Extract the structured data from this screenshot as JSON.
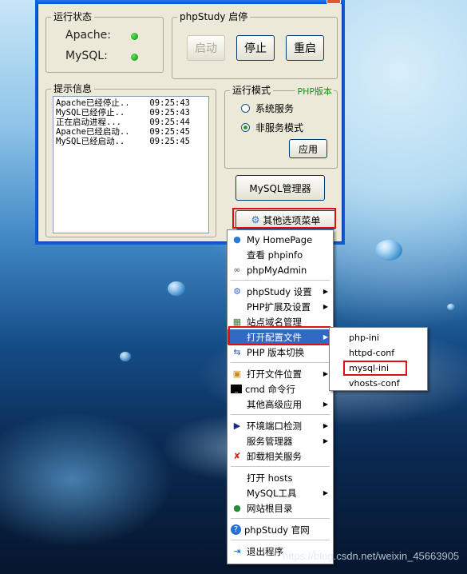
{
  "status_group": {
    "label": "运行状态",
    "apache": "Apache:",
    "mysql": "MySQL:"
  },
  "control_group": {
    "label": "phpStudy 启停",
    "start": "启动",
    "stop": "停止",
    "restart": "重启"
  },
  "log_group": {
    "label": "提示信息",
    "lines": [
      {
        "msg": "Apache已经停止..",
        "time": "09:25:43"
      },
      {
        "msg": "MySQL已经停止..",
        "time": "09:25:43"
      },
      {
        "msg": "正在启动进程...",
        "time": "09:25:44"
      },
      {
        "msg": "Apache已经启动..",
        "time": "09:25:45"
      },
      {
        "msg": "MySQL已经启动..",
        "time": "09:25:45"
      }
    ]
  },
  "mode_group": {
    "label": "运行模式",
    "php_version": "PHP版本",
    "system_service": "系统服务",
    "non_service": "非服务模式",
    "apply": "应用"
  },
  "mysql_manager": "MySQL管理器",
  "other_menu": "其他选项菜单",
  "menu": {
    "items": [
      {
        "label": "My HomePage",
        "icon": "globe-icon"
      },
      {
        "label": "查看 phpinfo",
        "icon": ""
      },
      {
        "label": "phpMyAdmin",
        "icon": "link-icon"
      },
      {
        "label": "phpStudy 设置",
        "icon": "gear-icon",
        "submenu": true
      },
      {
        "label": "PHP扩展及设置",
        "icon": "",
        "submenu": true
      },
      {
        "label": "站点域名管理",
        "icon": "sites-icon"
      },
      {
        "label": "打开配置文件",
        "icon": "",
        "submenu": true
      },
      {
        "label": "PHP 版本切换",
        "icon": "switch-icon"
      },
      {
        "label": "打开文件位置",
        "icon": "folder-icon",
        "submenu": true
      },
      {
        "label": "cmd 命令行",
        "icon": "terminal-icon"
      },
      {
        "label": "其他高级应用",
        "icon": "",
        "submenu": true
      },
      {
        "label": "环境端口检测",
        "icon": "play-icon",
        "submenu": true
      },
      {
        "label": "服务管理器",
        "icon": "",
        "submenu": true
      },
      {
        "label": "卸载相关服务",
        "icon": "uninstall-icon"
      },
      {
        "label": "打开 hosts",
        "icon": ""
      },
      {
        "label": "MySQL工具",
        "icon": "",
        "submenu": true
      },
      {
        "label": "网站根目录",
        "icon": "webroot-icon"
      },
      {
        "label": "phpStudy 官网",
        "icon": "help-icon"
      },
      {
        "label": "退出程序",
        "icon": "exit-icon"
      }
    ]
  },
  "submenu": {
    "items": [
      "php-ini",
      "httpd-conf",
      "mysql-ini",
      "vhosts-conf"
    ]
  },
  "watermark": "https://blog.csdn.net/weixin_45663905",
  "colors": {
    "highlight": "#316ac5",
    "redbox": "#e01010",
    "led": "#1a9c1a"
  }
}
